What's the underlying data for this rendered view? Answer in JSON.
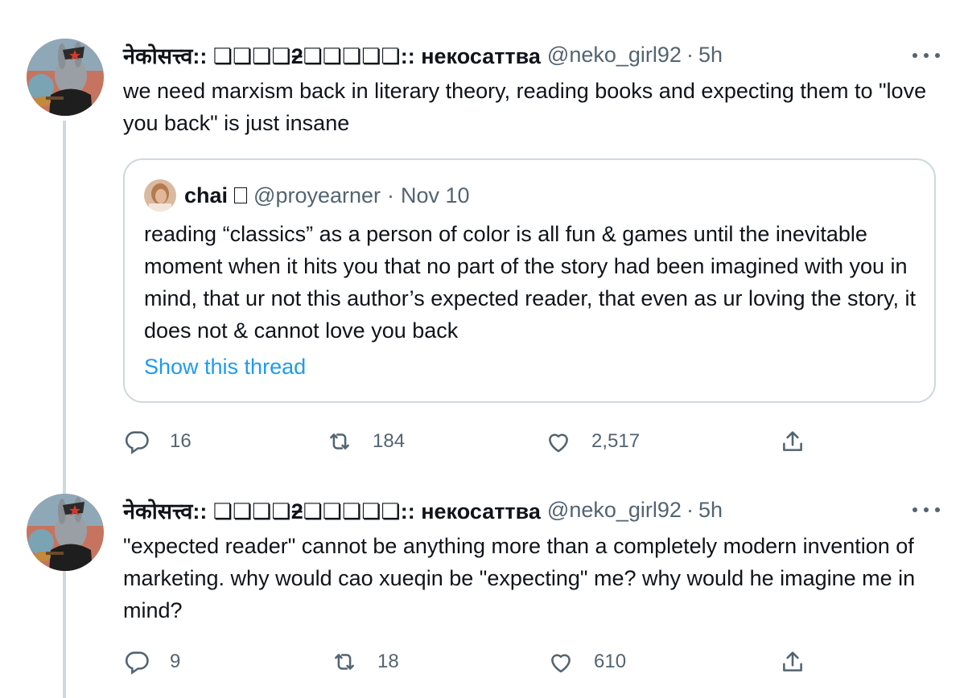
{
  "tweets": [
    {
      "author_name": "नेकोसत्त्व:: ❏❏❏❏ƻ❏❏❏❏❏:: некосаттва",
      "handle": "@neko_girl92",
      "separator": "·",
      "time": "5h",
      "text": "we need marxism back in literary theory, reading books and expecting them to \"love you back\" is just insane",
      "quote": {
        "author_name": "chai",
        "badge": "▯",
        "handle": "@proyearner",
        "separator": "·",
        "date": "Nov 10",
        "text": "reading “classics” as a person of color is all fun & games until the inevitable moment when it hits you that no part of the story had been imagined with you in mind, that ur not this author’s expected reader, that even as ur loving the story, it does not & cannot love you back",
        "show_thread_label": "Show this thread"
      },
      "stats": {
        "replies": "16",
        "retweets": "184",
        "likes": "2,517"
      }
    },
    {
      "author_name": "नेकोसत्त्व:: ❏❏❏❏ƻ❏❏❏❏❏:: некосаттва",
      "handle": "@neko_girl92",
      "separator": "·",
      "time": "5h",
      "text": "\"expected reader\" cannot be anything more than a completely modern invention of marketing. why would cao xueqin be \"expecting\" me? why would he imagine me in mind?",
      "stats": {
        "replies": "9",
        "retweets": "18",
        "likes": "610"
      }
    }
  ],
  "icons": {
    "reply": "reply-icon",
    "retweet": "retweet-icon",
    "like": "heart-icon",
    "share": "share-icon",
    "more": "more-icon"
  },
  "colors": {
    "link": "#1d9bf0",
    "secondary_text": "#536471",
    "border": "#cfd9de"
  }
}
